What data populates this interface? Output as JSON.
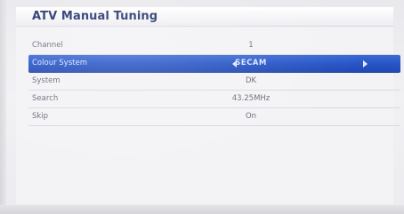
{
  "menu": {
    "title": "ATV Manual Tuning",
    "rows": [
      {
        "label": "Channel",
        "value": "1",
        "selected": false
      },
      {
        "label": "Colour System",
        "value": "SECAM",
        "selected": true
      },
      {
        "label": "System",
        "value": "DK",
        "selected": false
      },
      {
        "label": "Search",
        "value": "43.25MHz",
        "selected": false
      },
      {
        "label": "Skip",
        "value": "On",
        "selected": false
      }
    ]
  },
  "icons": {
    "selected_left": "triangle-left-icon",
    "selected_right": "triangle-right-icon"
  },
  "colors": {
    "title": "#1f2f6b",
    "highlight": "#2856c7",
    "text": "#6a6a78",
    "panel": "#f3f3f6"
  }
}
